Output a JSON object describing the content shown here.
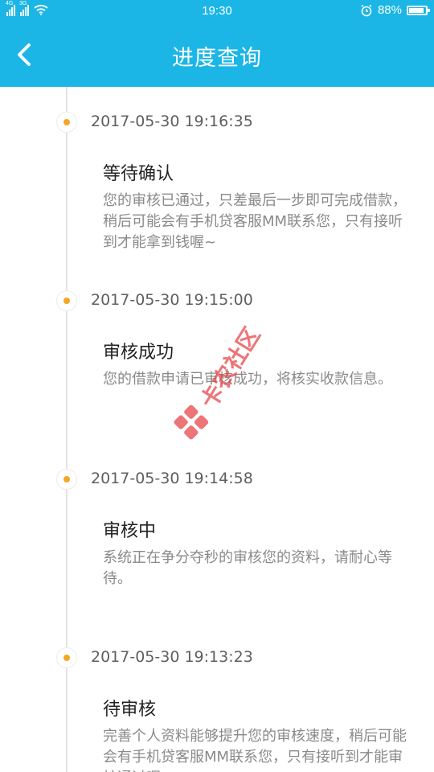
{
  "status_bar": {
    "network_1": "4G",
    "network_2": "3G",
    "time": "19:30",
    "battery": "88%",
    "battery_level": 0.88
  },
  "header": {
    "back_icon": "chevron-left-icon",
    "title": "进度查询"
  },
  "timeline": [
    {
      "time": "2017-05-30 19:16:35",
      "title": "等待确认",
      "desc": "您的审核已通过，只差最后一步即可完成借款，稍后可能会有手机贷客服MM联系您，只有接听到才能拿到钱喔~"
    },
    {
      "time": "2017-05-30 19:15:00",
      "title": "审核成功",
      "desc": "您的借款申请已审核成功，将核实收款信息。"
    },
    {
      "time": "2017-05-30 19:14:58",
      "title": "审核中",
      "desc": "系统正在争分夺秒的审核您的资料，请耐心等待。"
    },
    {
      "time": "2017-05-30 19:13:23",
      "title": "待审核",
      "desc": "完善个人资料能够提升您的审核速度，稍后可能会有手机贷客服MM联系您，只有接听到才能审核通过喔"
    }
  ],
  "watermark": {
    "text": "卡农社区"
  },
  "colors": {
    "accent": "#1bb6e6",
    "dot": "#f5a623",
    "watermark": "#e8474a"
  }
}
